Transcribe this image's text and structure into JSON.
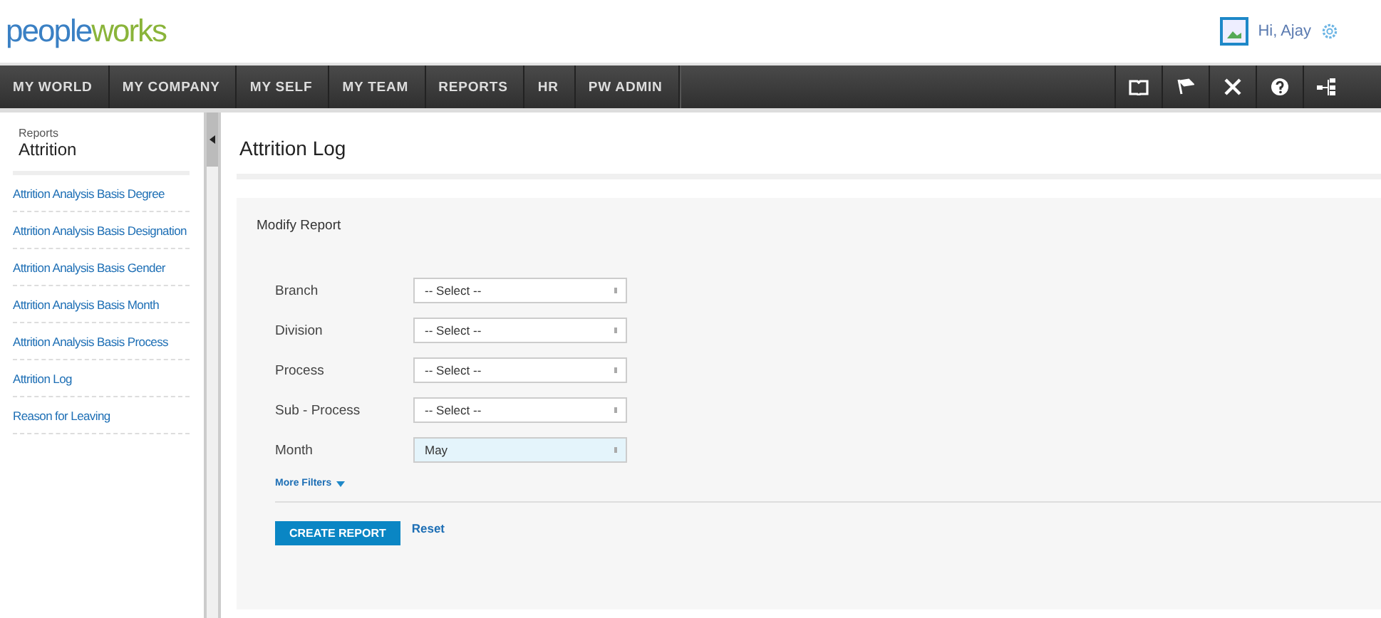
{
  "logo": {
    "part_1": "people",
    "part_2": "works"
  },
  "user": {
    "greeting": "Hi, Ajay"
  },
  "nav": [
    {
      "label": "MY WORLD",
      "selected": false
    },
    {
      "label": "MY COMPANY",
      "selected": false
    },
    {
      "label": "MY SELF",
      "selected": false
    },
    {
      "label": "MY TEAM",
      "selected": false
    },
    {
      "label": "REPORTS",
      "selected": false
    },
    {
      "label": "HR",
      "selected": false
    },
    {
      "label": "PW ADMIN",
      "selected": false
    }
  ],
  "toolbar": [
    {
      "kind": "book"
    },
    {
      "kind": "flag"
    },
    {
      "kind": "tools"
    },
    {
      "kind": "help"
    },
    {
      "kind": "tree"
    }
  ],
  "sidebar": {
    "section": "Reports",
    "title": "Attrition",
    "items": [
      {
        "label": "Attrition Analysis Basis Degree",
        "selected": false
      },
      {
        "label": "Attrition Analysis Basis Designation",
        "selected": false
      },
      {
        "label": "Attrition Analysis Basis Gender",
        "selected": false
      },
      {
        "label": "Attrition Analysis Basis Month",
        "selected": false
      },
      {
        "label": "Attrition Analysis Basis Process",
        "selected": false
      },
      {
        "label": "Attrition Log",
        "selected": false
      },
      {
        "label": "Reason for Leaving",
        "selected": false
      }
    ]
  },
  "page_title": "Attrition Log",
  "form": {
    "title": "Modify Report",
    "fields": [
      {
        "label": "Branch",
        "value": "-- Select --",
        "focused": false
      },
      {
        "label": "Division",
        "value": "-- Select --",
        "focused": false
      },
      {
        "label": "Process",
        "value": "-- Select --",
        "focused": false
      },
      {
        "label": "Sub - Process",
        "value": "-- Select --",
        "focused": false
      },
      {
        "label": "Month",
        "value": "May",
        "focused": true
      }
    ],
    "more_filters": "More Filters",
    "submit": "CREATE REPORT",
    "reset": "Reset"
  }
}
